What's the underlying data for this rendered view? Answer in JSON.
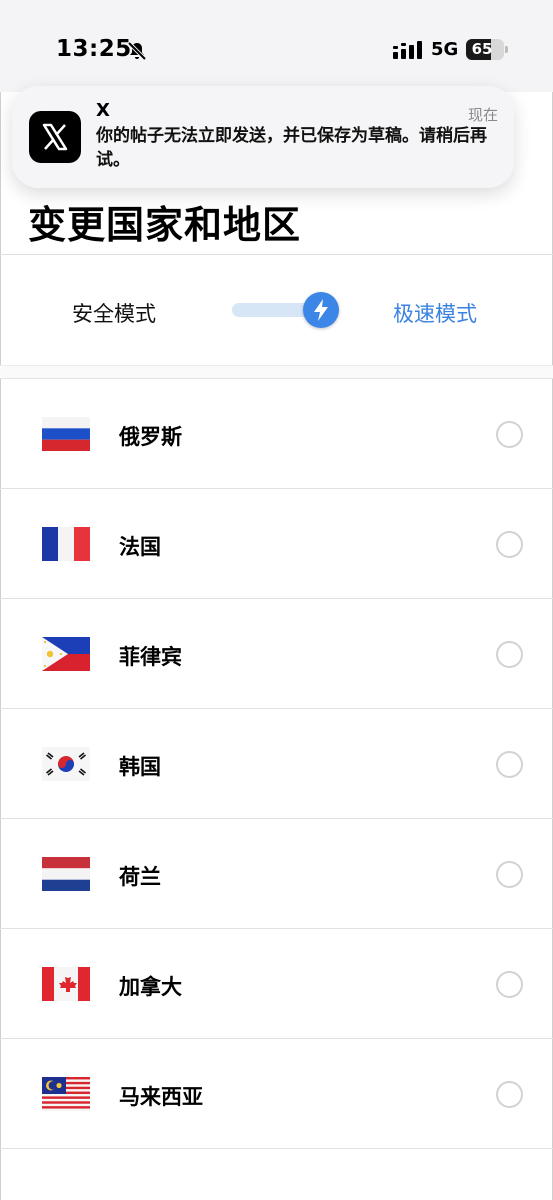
{
  "status_bar": {
    "time": "13:25",
    "network": "5G",
    "battery": "65",
    "icons": [
      "bell-slash-icon",
      "signal-icon",
      "battery-icon"
    ]
  },
  "notification": {
    "app_name": "X",
    "message": "你的帖子无法立即发送，并已保存为草稿。请稍后再试。",
    "time": "现在",
    "icon": "x-logo-icon"
  },
  "page": {
    "title": "变更国家和地区"
  },
  "mode_switch": {
    "left_label": "安全模式",
    "right_label": "极速模式",
    "selected": "极速模式",
    "active_color": "#3b86e6",
    "knob_icon": "lightning-icon"
  },
  "countries": [
    {
      "name": "俄罗斯",
      "flag": "russia-flag",
      "selected": false
    },
    {
      "name": "法国",
      "flag": "france-flag",
      "selected": false
    },
    {
      "name": "菲律宾",
      "flag": "philippines-flag",
      "selected": false
    },
    {
      "name": "韩国",
      "flag": "south-korea-flag",
      "selected": false
    },
    {
      "name": "荷兰",
      "flag": "netherlands-flag",
      "selected": false
    },
    {
      "name": "加拿大",
      "flag": "canada-flag",
      "selected": false
    },
    {
      "name": "马来西亚",
      "flag": "malaysia-flag",
      "selected": false
    }
  ]
}
